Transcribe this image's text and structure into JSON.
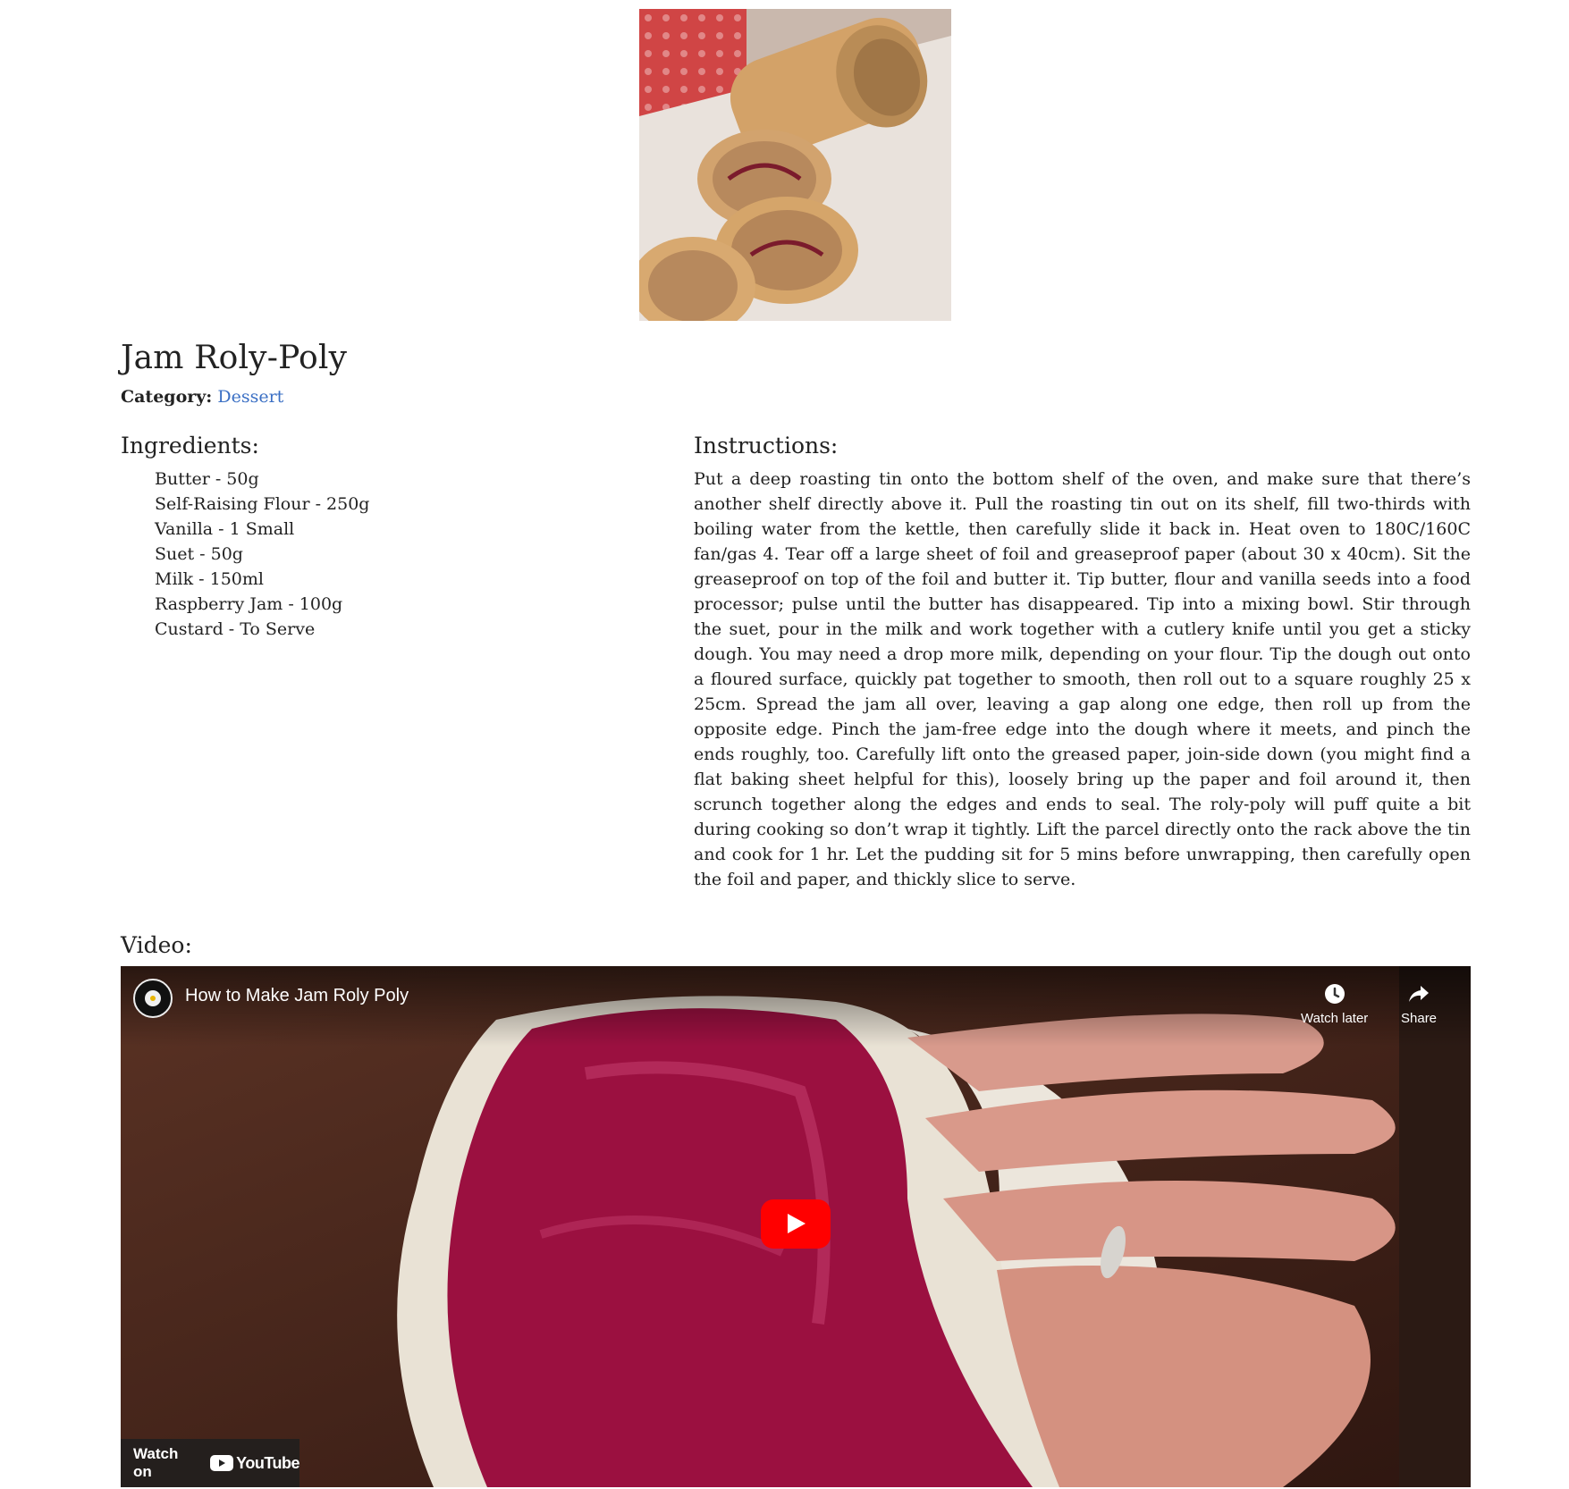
{
  "recipe": {
    "title": "Jam Roly-Poly",
    "category_label": "Category:",
    "category_value": "Dessert"
  },
  "ingredients": {
    "heading": "Ingredients:",
    "items": [
      "Butter - 50g",
      "Self-Raising Flour - 250g",
      "Vanilla - 1 Small",
      "Suet - 50g",
      "Milk - 150ml",
      "Raspberry Jam - 100g",
      "Custard - To Serve"
    ]
  },
  "instructions": {
    "heading": "Instructions:",
    "text": "Put a deep roasting tin onto the bottom shelf of the oven, and make sure that there’s another shelf directly above it. Pull the roasting tin out on its shelf, fill two-thirds with boiling water from the kettle, then carefully slide it back in. Heat oven to 180C/160C fan/gas 4. Tear off a large sheet of foil and greaseproof paper (about 30 x 40cm). Sit the greaseproof on top of the foil and butter it. Tip butter, flour and vanilla seeds into a food processor; pulse until the butter has disappeared. Tip into a mixing bowl. Stir through the suet, pour in the milk and work together with a cutlery knife until you get a sticky dough. You may need a drop more milk, depending on your flour. Tip the dough out onto a floured surface, quickly pat together to smooth, then roll out to a square roughly 25 x 25cm. Spread the jam all over, leaving a gap along one edge, then roll up from the opposite edge. Pinch the jam-free edge into the dough where it meets, and pinch the ends roughly, too. Carefully lift onto the greased paper, join-side down (you might find a flat baking sheet helpful for this), loosely bring up the paper and foil around it, then scrunch together along the edges and ends to seal. The roly-poly will puff quite a bit during cooking so don’t wrap it tightly. Lift the parcel directly onto the rack above the tin and cook for 1 hr. Let the pudding sit for 5 mins before unwrapping, then carefully open the foil and paper, and thickly slice to serve."
  },
  "video": {
    "heading": "Video:",
    "title": "How to Make Jam Roly Poly",
    "watch_later_label": "Watch later",
    "share_label": "Share",
    "watch_on_label": "Watch on",
    "youtube_label": "YouTube"
  },
  "icons": {
    "thumbnail": "recipe-photo",
    "play": "play-icon",
    "clock": "clock-icon",
    "share": "share-arrow-icon"
  },
  "colors": {
    "link": "#3a6fc4",
    "play_button": "#ff0000",
    "jam": "#9b1040"
  }
}
